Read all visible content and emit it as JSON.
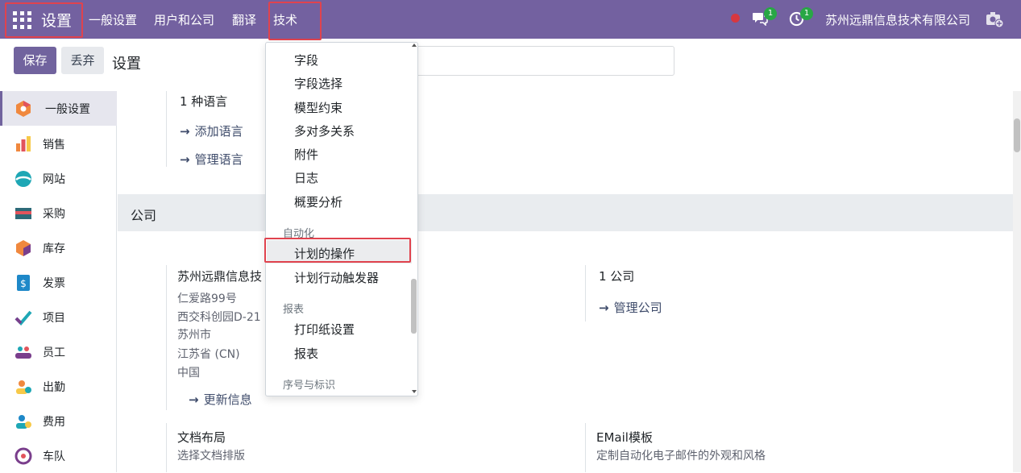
{
  "topbar": {
    "app_title": "设置",
    "menus": [
      "一般设置",
      "用户和公司",
      "翻译",
      "技术"
    ],
    "chat_count": "1",
    "activity_count": "1",
    "company_name": "苏州远鼎信息技术有限公司",
    "colors": {
      "bar": "#7361a0",
      "highlight": "#e0434e",
      "badge": "#28a745"
    }
  },
  "control": {
    "save_label": "保存",
    "discard_label": "丢弃",
    "title": "设置"
  },
  "sidebar": {
    "items": [
      {
        "label": "一般设置",
        "icon": "settings-icon"
      },
      {
        "label": "销售",
        "icon": "sales-icon"
      },
      {
        "label": "网站",
        "icon": "website-icon"
      },
      {
        "label": "采购",
        "icon": "purchase-icon"
      },
      {
        "label": "库存",
        "icon": "inventory-icon"
      },
      {
        "label": "发票",
        "icon": "invoice-icon"
      },
      {
        "label": "项目",
        "icon": "project-icon"
      },
      {
        "label": "员工",
        "icon": "employees-icon"
      },
      {
        "label": "出勤",
        "icon": "attendance-icon"
      },
      {
        "label": "费用",
        "icon": "expenses-icon"
      },
      {
        "label": "车队",
        "icon": "fleet-icon"
      }
    ]
  },
  "languages": {
    "count_label": "1 种语言",
    "add_link": "添加语言",
    "manage_link": "管理语言"
  },
  "company_section": {
    "header": "公司",
    "company_name_truncated": "苏州远鼎信息技",
    "address_lines": [
      "仁爱路99号",
      "西交科创园D-21",
      "苏州市",
      "江苏省 (CN)",
      "中国"
    ],
    "update_link": "更新信息",
    "companies_count": "1 公司",
    "manage_companies_link": "管理公司",
    "doc_layout_title": "文档布局",
    "doc_layout_desc": "选择文档排版",
    "email_template_title": "EMail模板",
    "email_template_desc": "定制自动化电子邮件的外观和风格"
  },
  "dropdown": {
    "items_top": [
      "字段",
      "字段选择",
      "模型约束",
      "多对多关系",
      "附件",
      "日志",
      "概要分析"
    ],
    "header_automation": "自动化",
    "automation_items": [
      "计划的操作",
      "计划行动触发器"
    ],
    "header_reports": "报表",
    "report_items": [
      "打印纸设置",
      "报表"
    ],
    "header_sequences": "序号与标识"
  }
}
